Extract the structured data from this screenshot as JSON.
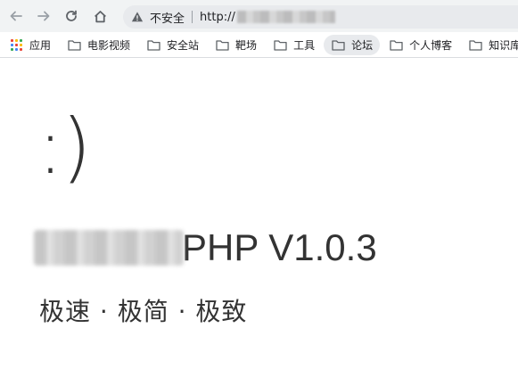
{
  "browser": {
    "security_label": "不安全",
    "url_prefix": "http://",
    "icons": [
      "back-arrow-icon",
      "forward-arrow-icon",
      "reload-icon",
      "home-icon",
      "warning-icon"
    ]
  },
  "bookmarks": [
    {
      "label": "应用",
      "icon": "apps-grid-icon"
    },
    {
      "label": "电影视频",
      "icon": "folder-icon"
    },
    {
      "label": "安全站",
      "icon": "folder-icon"
    },
    {
      "label": "靶场",
      "icon": "folder-icon"
    },
    {
      "label": "工具",
      "icon": "folder-icon"
    },
    {
      "label": "论坛",
      "icon": "folder-icon"
    },
    {
      "label": "个人博客",
      "icon": "folder-icon"
    },
    {
      "label": "知识库",
      "icon": "folder-icon"
    }
  ],
  "page": {
    "smiley": ":)",
    "title_suffix": "PHP V1.0.3",
    "subtitle": "极速 · 极简 · 极致"
  },
  "colors": {
    "toolbar_bg": "#f1f3f4",
    "omnibox_bg": "#e8eaed",
    "text": "#333333"
  }
}
